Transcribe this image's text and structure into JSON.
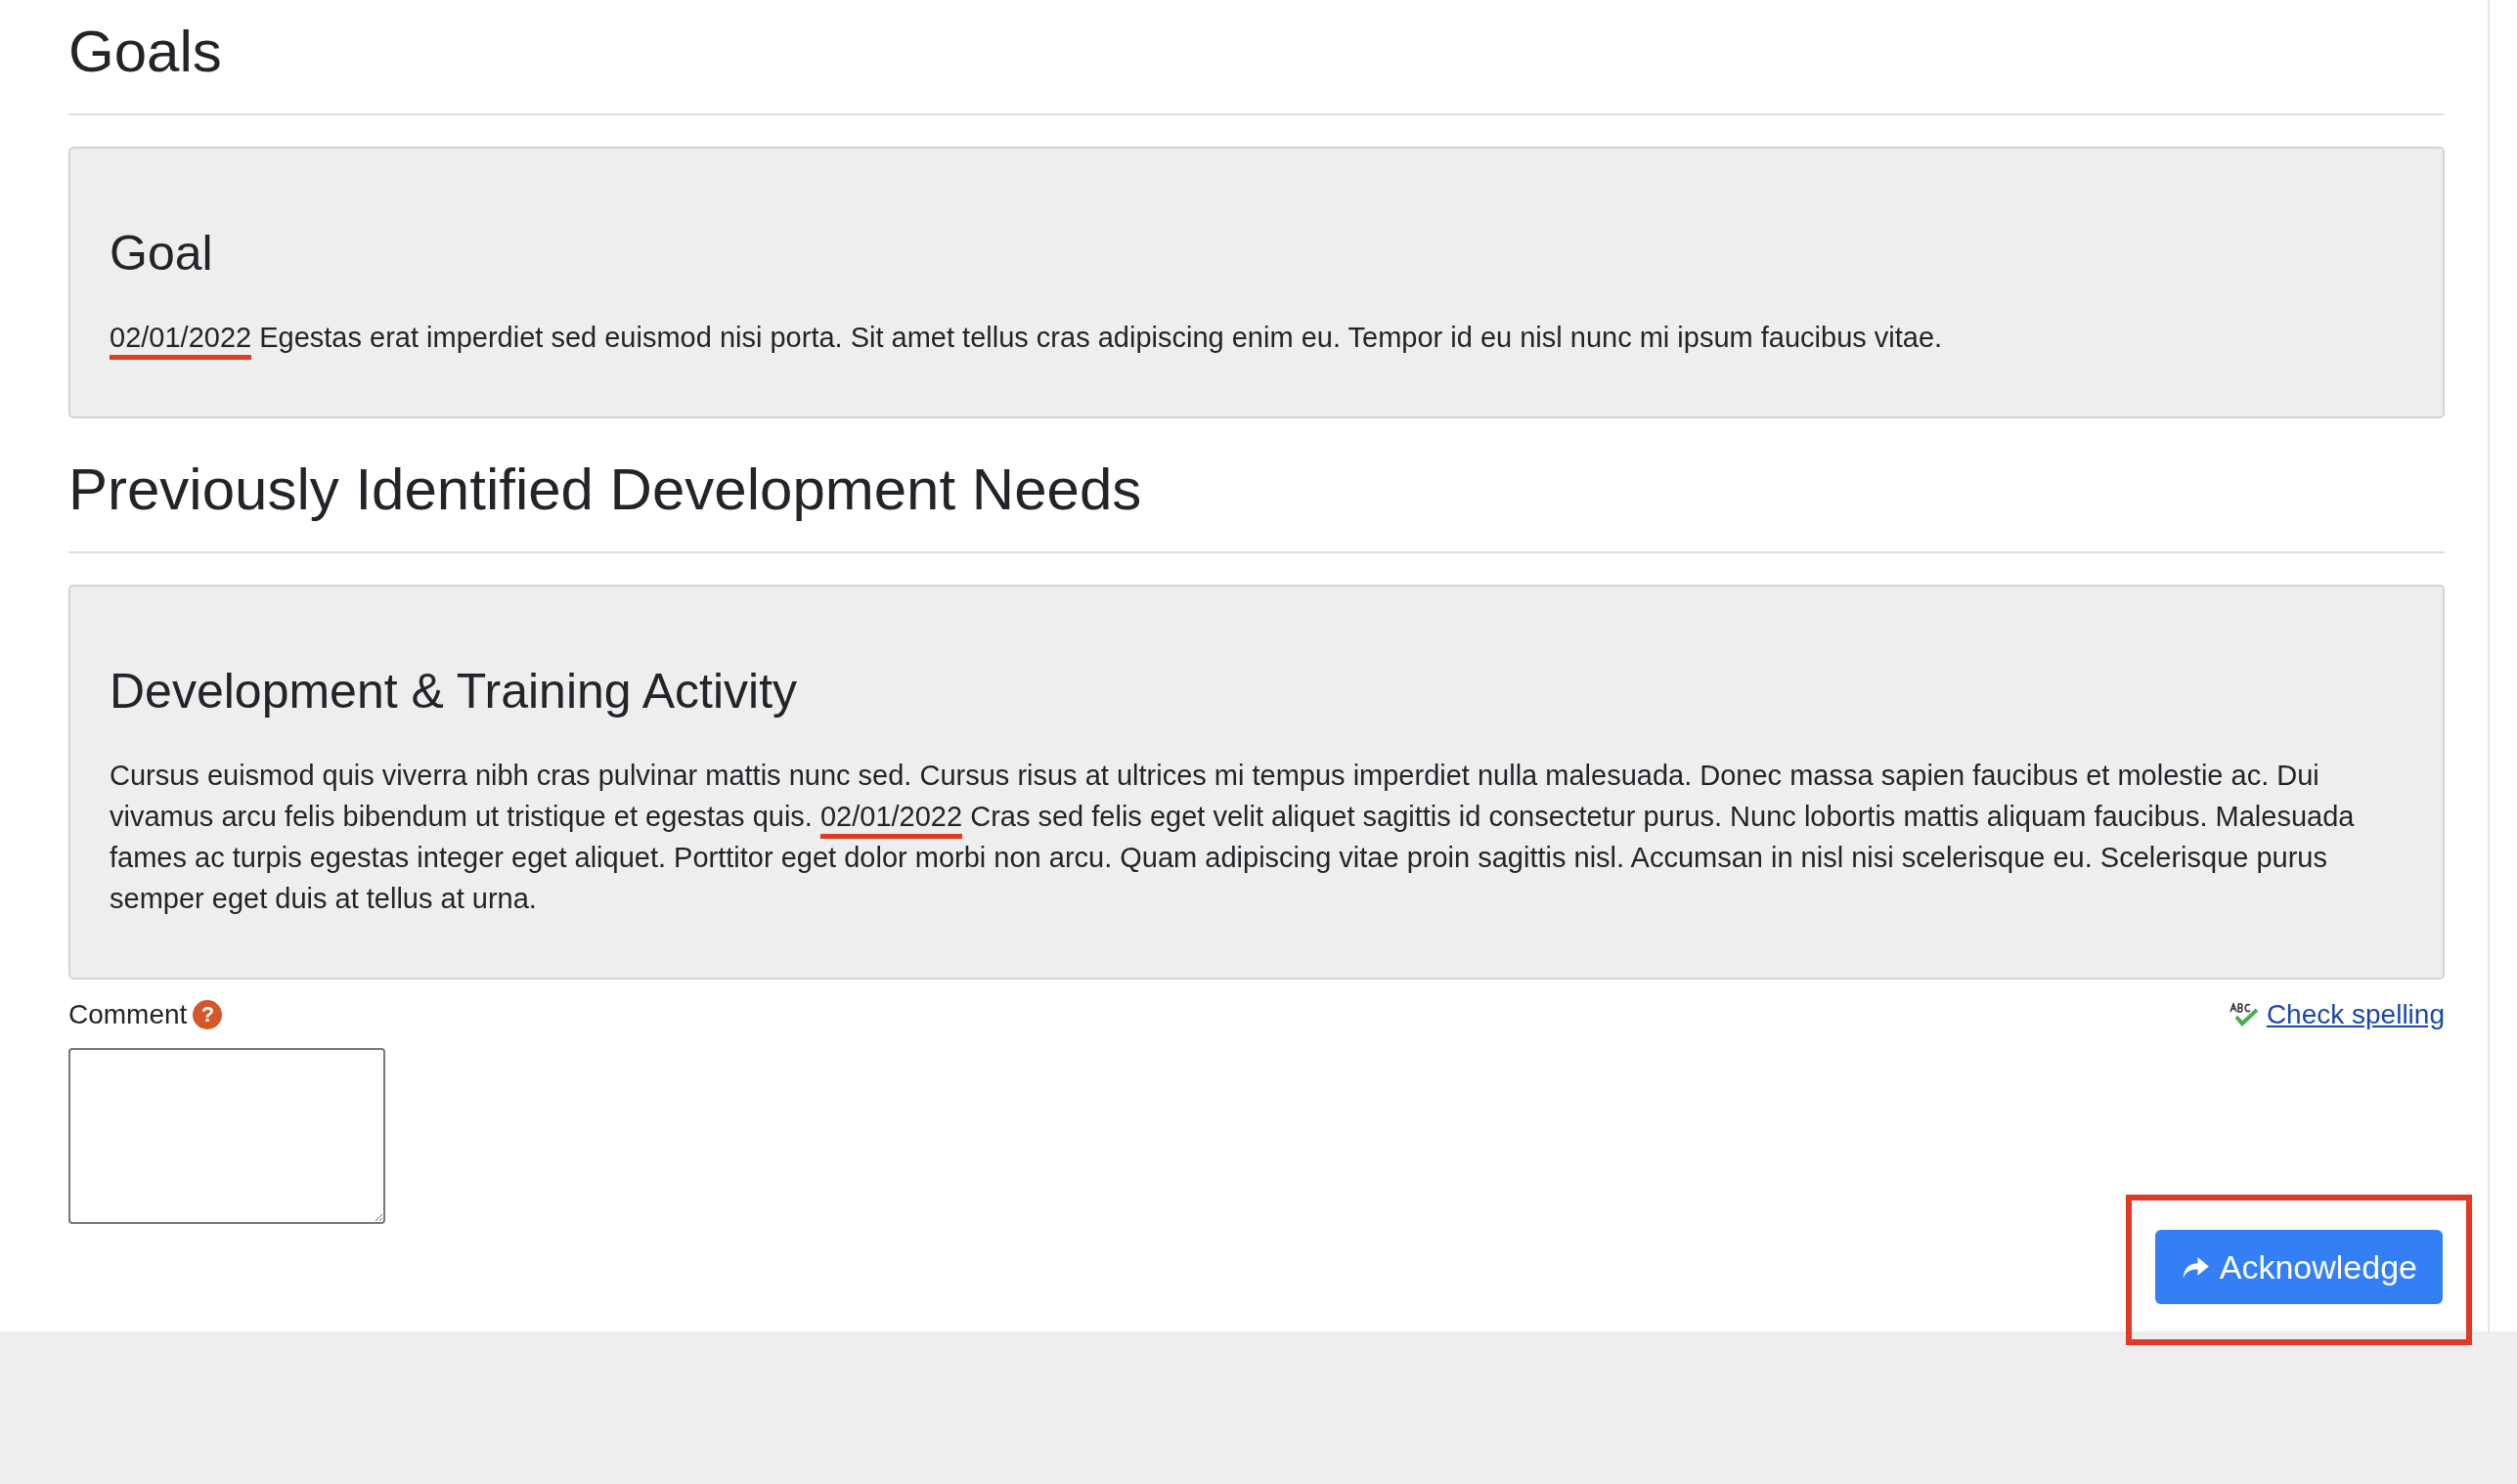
{
  "sections": [
    {
      "title": "Goals",
      "card": {
        "title": "Goal",
        "date": "02/01/2022",
        "text_after": " Egestas erat imperdiet sed euismod nisi porta. Sit amet tellus cras adipiscing enim eu. Tempor id eu nisl nunc mi ipsum faucibus vitae."
      }
    },
    {
      "title": "Previously Identified Development Needs",
      "card": {
        "title": "Development & Training Activity",
        "text_before": "Cursus euismod quis viverra nibh cras pulvinar mattis nunc sed. Cursus risus at ultrices mi tempus imperdiet nulla malesuada. Donec massa sapien faucibus et molestie ac. Dui vivamus arcu felis bibendum ut tristique et egestas quis. ",
        "date": "02/01/2022",
        "text_after": " Cras sed felis eget velit aliquet sagittis id consectetur purus. Nunc lobortis mattis aliquam faucibus. Malesuada fames ac turpis egestas integer eget aliquet. Porttitor eget dolor morbi non arcu. Quam adipiscing vitae proin sagittis nisl. Accumsan in nisl nisi scelerisque eu. Scelerisque purus semper eget duis at tellus at urna."
      }
    }
  ],
  "comment": {
    "label": "Comment",
    "help": "?",
    "check_spelling": "Check spelling"
  },
  "button": {
    "label": "Acknowledge",
    "highlighted": true
  }
}
